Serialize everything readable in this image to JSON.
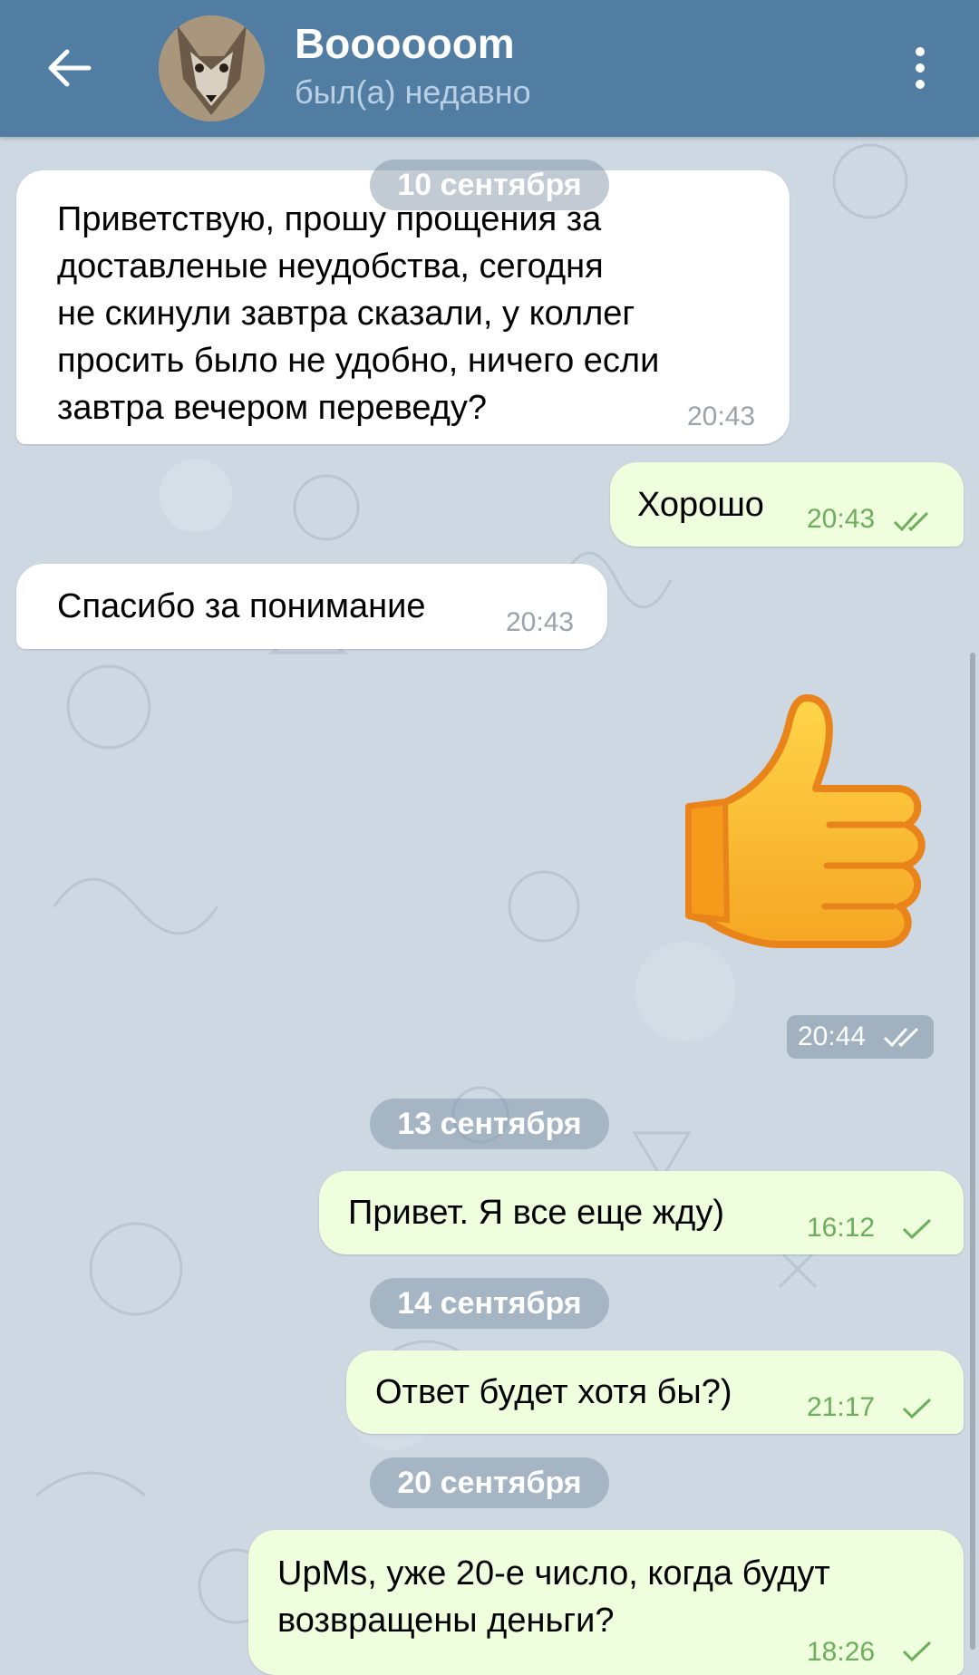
{
  "header": {
    "title": "Boooooom",
    "status": "был(а) недавно"
  },
  "icons": {
    "back": "arrow-left-icon",
    "menu": "more-vertical-icon",
    "read": "double-check-icon",
    "sent": "single-check-icon"
  },
  "colors": {
    "header_bg": "#527da3",
    "incoming_bubble": "#ffffff",
    "outgoing_bubble": "#effedd",
    "time_outgoing": "#6cae5b"
  },
  "dates": {
    "d1": "10 сентября",
    "d2": "13 сентября",
    "d3": "14 сентября",
    "d4": "20 сентября"
  },
  "messages": {
    "m1": {
      "lines": [
        "Приветствую, прошу прощения за",
        "доставленые неудобства, сегодня",
        "не скинули завтра сказали, у коллег",
        "просить было не удобно, ничего если",
        "завтра вечером переведу?"
      ],
      "time": "20:43"
    },
    "m2": {
      "text": "Хорошо",
      "time": "20:43"
    },
    "m3": {
      "text": "Спасибо за понимание",
      "time": "20:43"
    },
    "m4": {
      "sticker": "thumbs-up",
      "time": "20:44"
    },
    "m5": {
      "text": "Привет. Я все еще жду)",
      "time": "16:12"
    },
    "m6": {
      "text": "Ответ будет хотя бы?)",
      "time": "21:17"
    },
    "m7": {
      "lines": [
        "UpMs, уже 20-е число, когда будут",
        "возвращены деньги?"
      ],
      "time": "18:26"
    }
  }
}
